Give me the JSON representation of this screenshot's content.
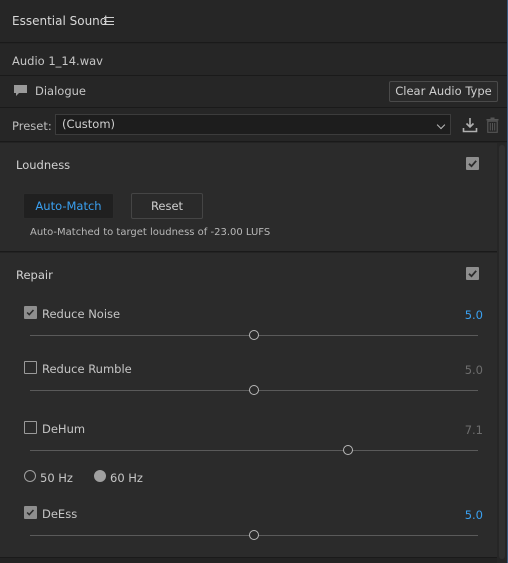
{
  "panel": {
    "title": "Essential Sound",
    "file_name": "Audio 1_14.wav",
    "audio_type": "Dialogue",
    "clear_button": "Clear Audio Type"
  },
  "preset": {
    "label": "Preset:",
    "value": "(Custom)"
  },
  "loudness": {
    "title": "Loudness",
    "enabled": true,
    "auto_match_label": "Auto-Match",
    "reset_label": "Reset",
    "note": "Auto-Matched to target loudness of -23.00 LUFS"
  },
  "repair": {
    "title": "Repair",
    "enabled": true,
    "items": [
      {
        "label": "Reduce Noise",
        "checked": true,
        "value": "5.0",
        "slider": 0.5
      },
      {
        "label": "Reduce Rumble",
        "checked": false,
        "value": "5.0",
        "slider": 0.5
      },
      {
        "label": "DeHum",
        "checked": false,
        "value": "7.1",
        "slider": 0.71
      },
      {
        "label": "DeEss",
        "checked": true,
        "value": "5.0",
        "slider": 0.5
      }
    ],
    "hum_options": [
      {
        "label": "50 Hz",
        "selected": false
      },
      {
        "label": "60 Hz",
        "selected": true
      }
    ]
  },
  "colors": {
    "accent": "#3aa0f0",
    "panel_bg": "#2b2b2b",
    "header_bg": "#262626"
  }
}
